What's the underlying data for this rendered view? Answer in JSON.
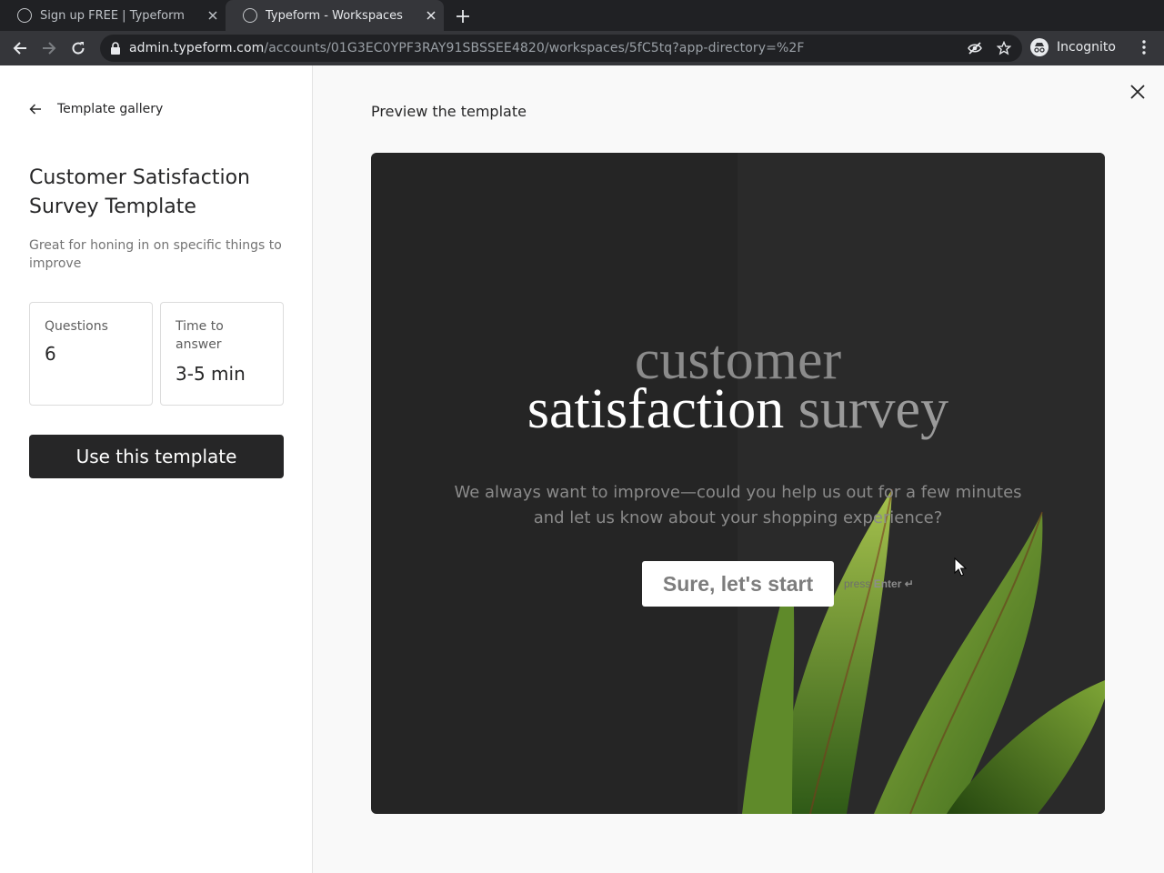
{
  "browser": {
    "tabs": [
      {
        "title": "Sign up FREE | Typeform",
        "active": false
      },
      {
        "title": "Typeform - Workspaces",
        "active": true
      }
    ],
    "url_host": "admin.typeform.com",
    "url_path": "/accounts/01G3EC0YPF3RAY91SBSSEE4820/workspaces/5fC5tq?app-directory=%2F",
    "profile_label": "Incognito"
  },
  "sidebar": {
    "back_label": "Template gallery",
    "title": "Customer Satisfaction Survey Template",
    "description": "Great for honing in on specific things to improve",
    "stats": {
      "questions_label": "Questions",
      "questions_value": "6",
      "time_label": "Time to answer",
      "time_value": "3-5 min"
    },
    "cta_label": "Use this template"
  },
  "preview": {
    "heading": "Preview the template",
    "title_line1": "customer",
    "title_line2_a": "satisfaction",
    "title_line2_b": "survey",
    "description": "We always want to improve—could you help us out for a few minutes and let us know about your shopping experience?",
    "start_label": "Sure, let's start",
    "hint_prefix": "press",
    "hint_key": "Enter ↵"
  },
  "colors": {
    "browser_dark": "#202124",
    "toolbar": "#35363a",
    "primary_button": "#262627",
    "preview_bg": "#252525"
  },
  "icons": [
    "close-icon",
    "arrow-left-icon",
    "reload-icon",
    "lock-icon",
    "star-icon",
    "eye-off-icon",
    "incognito-icon",
    "more-vert-icon",
    "plus-icon"
  ]
}
